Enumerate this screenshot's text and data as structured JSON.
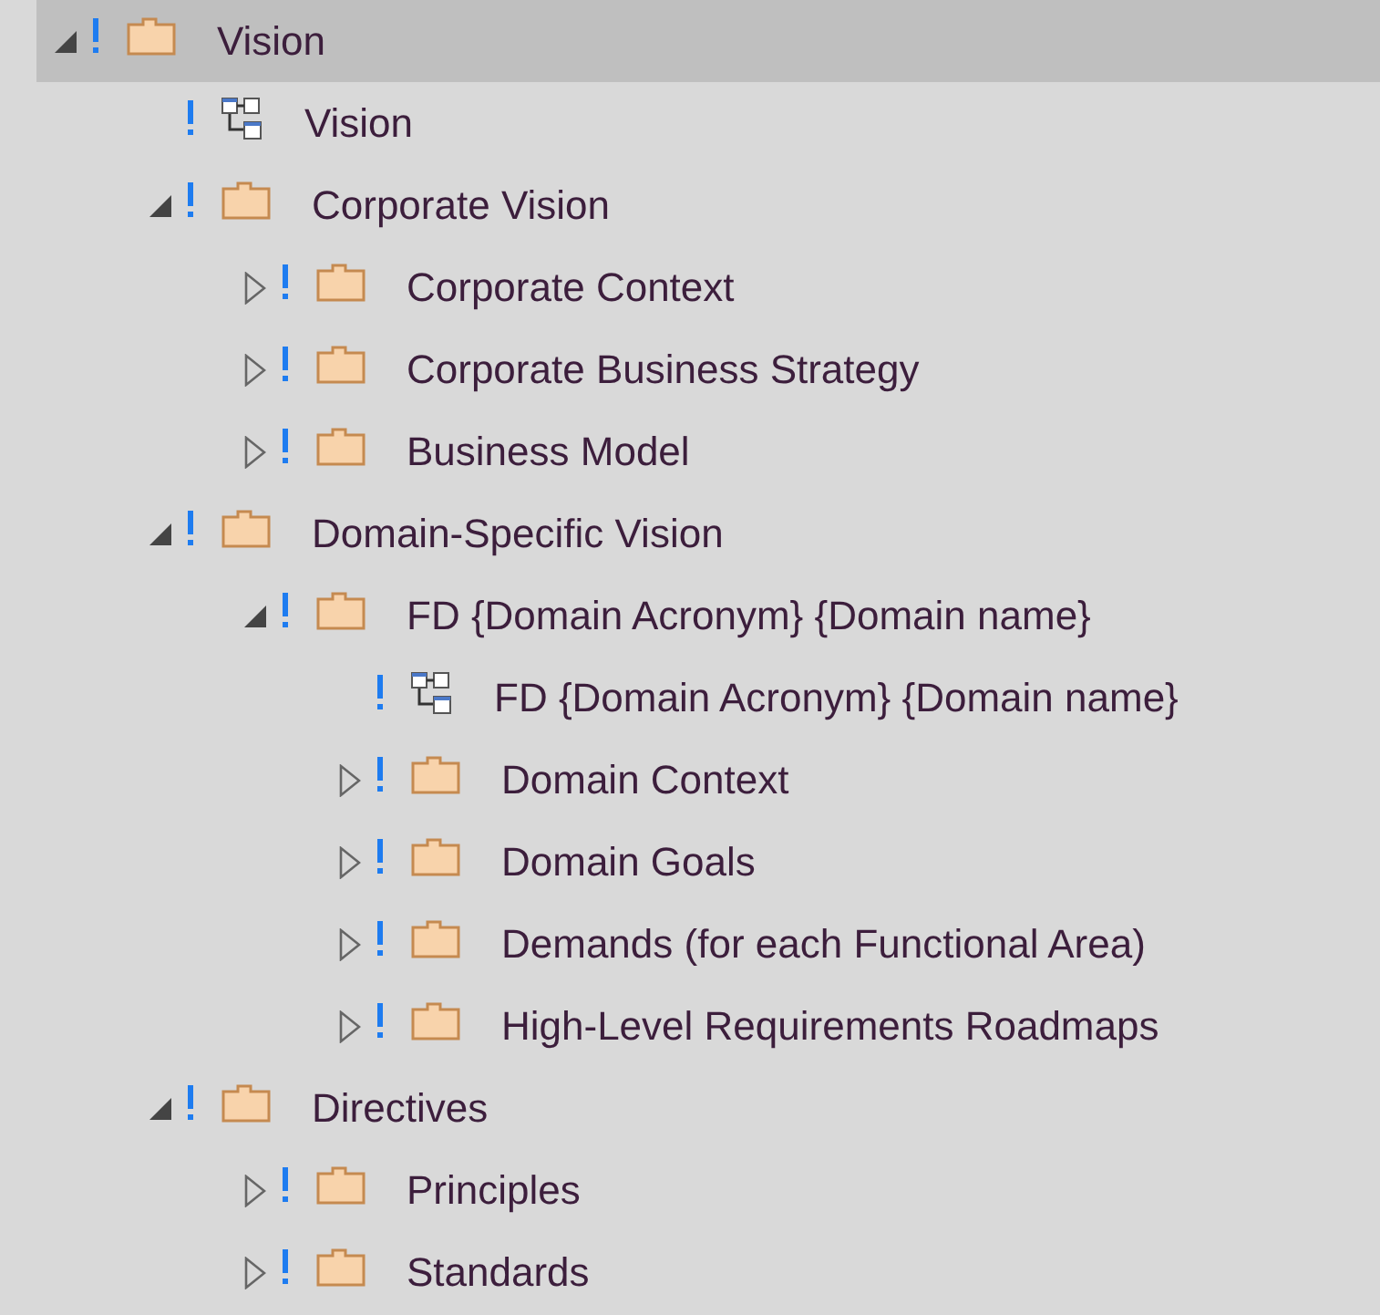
{
  "tree": [
    {
      "kind": "folder",
      "label": "Vision",
      "expanded": true,
      "selected": true,
      "children": [
        {
          "kind": "diagram",
          "label": "Vision",
          "selected": false
        },
        {
          "kind": "folder",
          "label": "Corporate Vision",
          "expanded": true,
          "selected": false,
          "children": [
            {
              "kind": "folder",
              "label": "Corporate Context",
              "expanded": false,
              "selected": false
            },
            {
              "kind": "folder",
              "label": "Corporate Business Strategy",
              "expanded": false,
              "selected": false
            },
            {
              "kind": "folder",
              "label": "Business Model",
              "expanded": false,
              "selected": false
            }
          ]
        },
        {
          "kind": "folder",
          "label": "Domain-Specific Vision",
          "expanded": true,
          "selected": false,
          "children": [
            {
              "kind": "folder",
              "label": "FD {Domain Acronym} {Domain name}",
              "expanded": true,
              "selected": false,
              "children": [
                {
                  "kind": "diagram",
                  "label": "FD {Domain Acronym} {Domain name}",
                  "selected": false
                },
                {
                  "kind": "folder",
                  "label": "Domain Context",
                  "expanded": false,
                  "selected": false
                },
                {
                  "kind": "folder",
                  "label": "Domain Goals",
                  "expanded": false,
                  "selected": false
                },
                {
                  "kind": "folder",
                  "label": "Demands (for each Functional Area)",
                  "expanded": false,
                  "selected": false
                },
                {
                  "kind": "folder",
                  "label": "High-Level Requirements Roadmaps",
                  "expanded": false,
                  "selected": false
                }
              ]
            }
          ]
        },
        {
          "kind": "folder",
          "label": "Directives",
          "expanded": true,
          "selected": false,
          "children": [
            {
              "kind": "folder",
              "label": "Principles",
              "expanded": false,
              "selected": false
            },
            {
              "kind": "folder",
              "label": "Standards",
              "expanded": false,
              "selected": false
            }
          ]
        }
      ]
    }
  ]
}
